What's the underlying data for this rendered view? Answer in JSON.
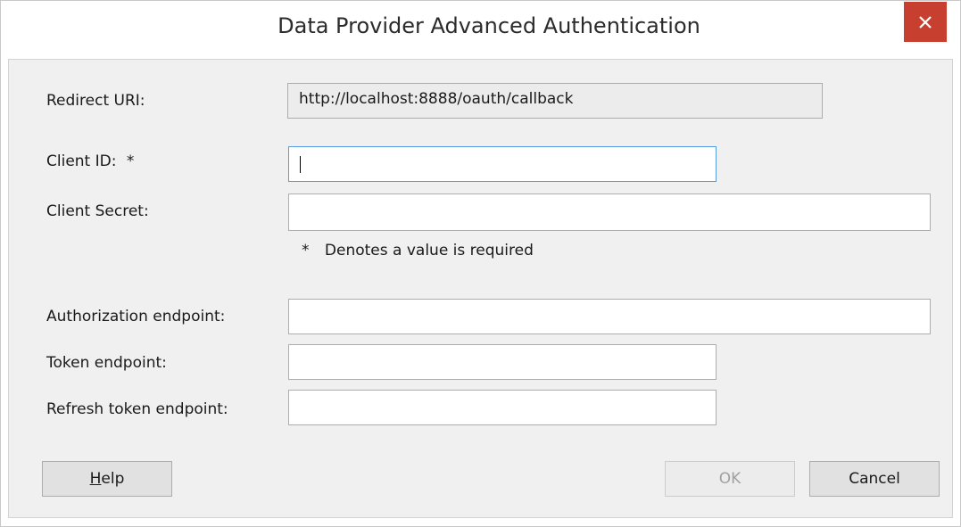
{
  "dialog": {
    "title": "Data Provider Advanced Authentication",
    "close_glyph": "✕"
  },
  "form": {
    "redirect_uri_label": "Redirect URI:",
    "redirect_uri_value": "http://localhost:8888/oauth/callback",
    "client_id_label": "Client ID:",
    "required_marker": "*",
    "client_id_value": "",
    "client_secret_label": "Client Secret:",
    "client_secret_value": "",
    "required_note": "Denotes a value is required",
    "authorization_endpoint_label": "Authorization endpoint:",
    "authorization_endpoint_value": "",
    "token_endpoint_label": "Token endpoint:",
    "token_endpoint_value": "",
    "refresh_token_endpoint_label": "Refresh token endpoint:",
    "refresh_token_endpoint_value": ""
  },
  "buttons": {
    "help_mnemonic": "H",
    "help_rest": "elp",
    "ok_label": "OK",
    "ok_enabled": false,
    "cancel_label": "Cancel"
  },
  "colors": {
    "close_button_bg": "#c7402f",
    "focus_border": "#569de5",
    "dialog_bg": "#f0f0f0"
  },
  "icons": {
    "close": "close-icon"
  }
}
